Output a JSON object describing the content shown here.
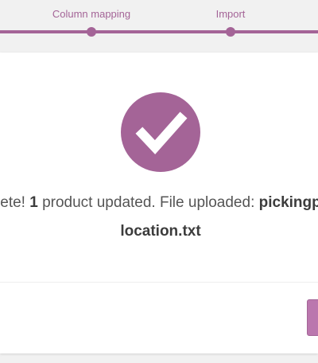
{
  "steps": {
    "column_mapping_label": "Column mapping",
    "import_label": "Import"
  },
  "result": {
    "message_prefix": "ete! ",
    "updated_count": "1",
    "message_middle": " product updated. File uploaded: ",
    "file_name_part1": "pickingp",
    "file_name_part2": "location.txt"
  },
  "icons": {
    "success": "checkmark-icon"
  },
  "colors": {
    "accent": "#a46497",
    "button": "#bb77ae",
    "text": "#555555",
    "background": "#f1f1f1"
  }
}
